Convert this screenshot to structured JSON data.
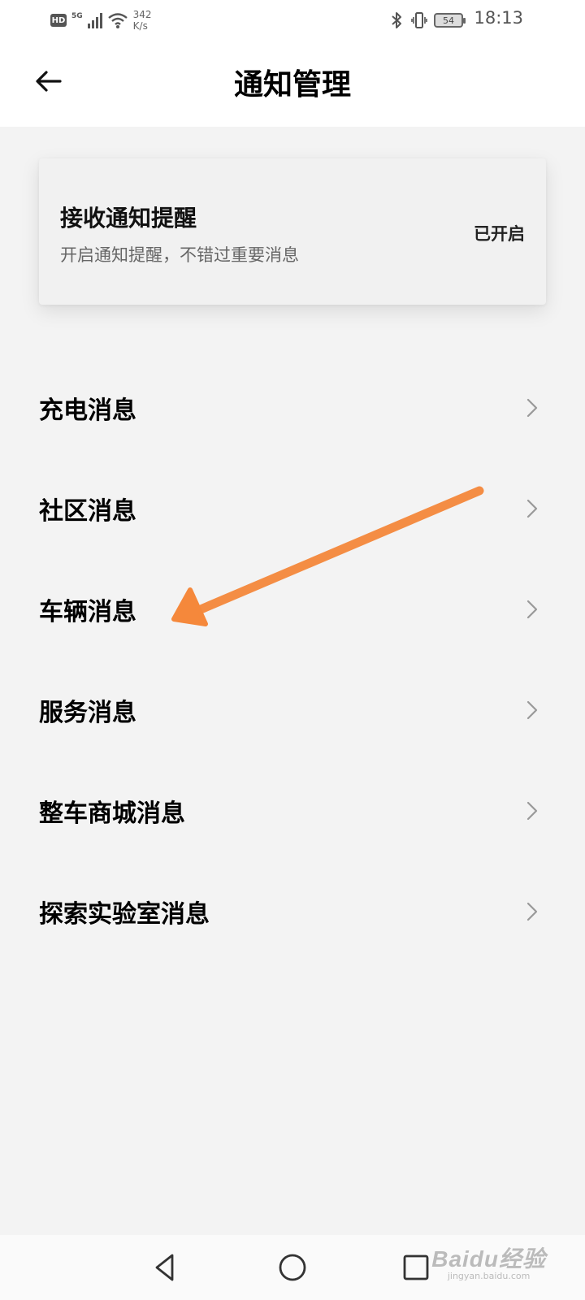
{
  "status_bar": {
    "hd": "HD",
    "network": "5G",
    "speed_value": "342",
    "speed_unit": "K/s",
    "battery": "54",
    "time": "18:13"
  },
  "header": {
    "title": "通知管理",
    "back_icon": "arrow-left-icon"
  },
  "notification_card": {
    "title": "接收通知提醒",
    "subtitle": "开启通知提醒，不错过重要消息",
    "status": "已开启"
  },
  "menu": {
    "items": [
      {
        "label": "充电消息"
      },
      {
        "label": "社区消息"
      },
      {
        "label": "车辆消息"
      },
      {
        "label": "服务消息"
      },
      {
        "label": "整车商城消息"
      },
      {
        "label": "探索实验室消息"
      }
    ]
  },
  "annotation": {
    "arrow_color": "#f5883b",
    "target": "车辆消息"
  },
  "nav": {
    "back_icon": "triangle-back-icon",
    "home_icon": "circle-home-icon",
    "recents_icon": "square-recents-icon"
  },
  "watermark": {
    "logo": "Baidu经验",
    "url": "jingyan.baidu.com"
  }
}
